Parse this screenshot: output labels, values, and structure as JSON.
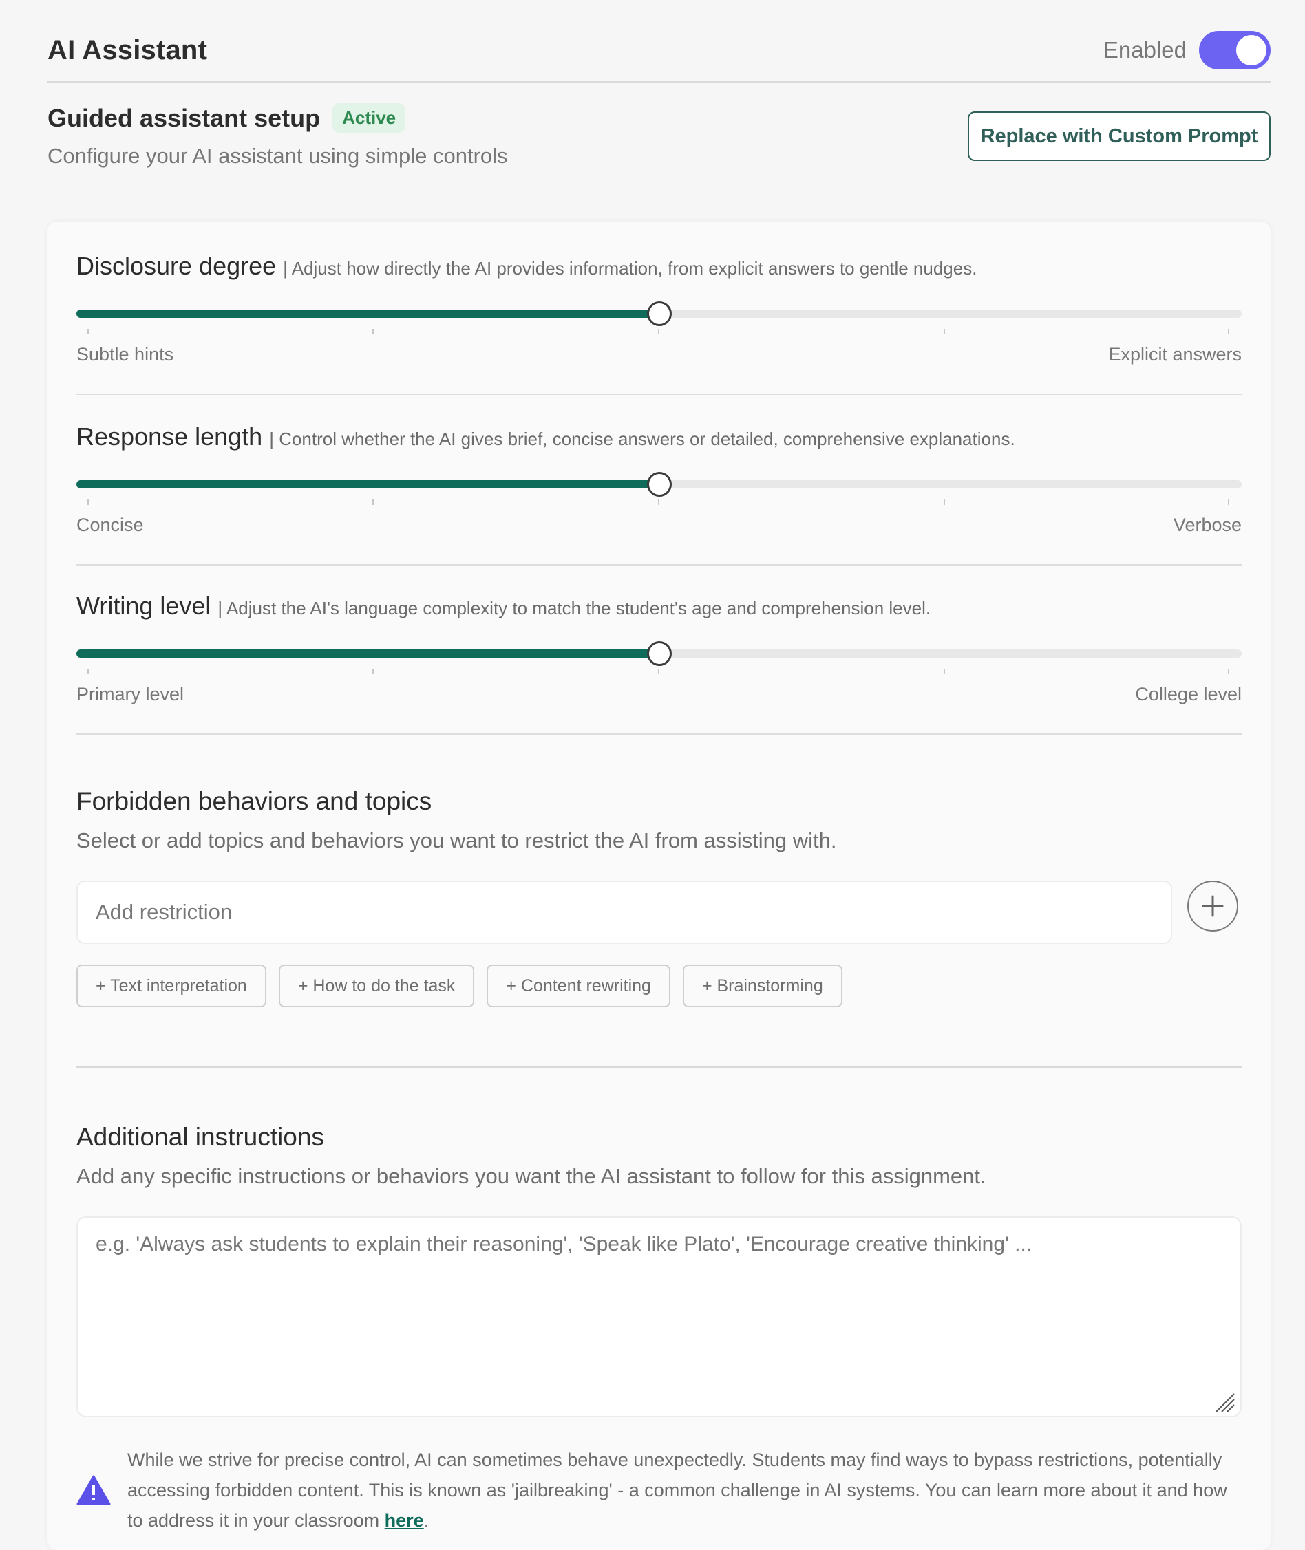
{
  "header": {
    "title": "AI Assistant",
    "enabled_label": "Enabled",
    "enabled": true
  },
  "guided": {
    "title": "Guided assistant setup",
    "badge": "Active",
    "subtitle": "Configure your AI assistant using simple controls",
    "replace_button": "Replace with Custom Prompt"
  },
  "sliders": [
    {
      "title": "Disclosure degree",
      "description": "| Adjust how directly the AI provides information, from explicit answers to gentle nudges.",
      "min_label": "Subtle hints",
      "max_label": "Explicit answers",
      "value": 0.5
    },
    {
      "title": "Response length",
      "description": "| Control whether the AI gives brief, concise answers or detailed, comprehensive explanations.",
      "min_label": "Concise",
      "max_label": "Verbose",
      "value": 0.5
    },
    {
      "title": "Writing level",
      "description": "| Adjust the AI's language complexity to match the student's age and comprehension level.",
      "min_label": "Primary level",
      "max_label": "College level",
      "value": 0.5
    }
  ],
  "forbidden": {
    "title": "Forbidden behaviors and topics",
    "subtitle": "Select or add topics and behaviors you want to restrict the AI from assisting with.",
    "input_placeholder": "Add restriction",
    "chips": [
      "+ Text interpretation",
      "+ How to do the task",
      "+ Content rewriting",
      "+ Brainstorming"
    ]
  },
  "instructions": {
    "title": "Additional instructions",
    "subtitle": "Add any specific instructions or behaviors you want the AI assistant to follow for this assignment.",
    "placeholder": "e.g. 'Always ask students to explain their reasoning', 'Speak like Plato', 'Encourage creative thinking' ..."
  },
  "warning": {
    "text": "While we strive for precise control, AI can sometimes behave unexpectedly. Students may find ways to bypass restrictions, potentially accessing forbidden content. This is known as 'jailbreaking' - a common challenge in AI systems. You can learn more about it and how to address it in your classroom ",
    "link_label": "here",
    "trailing": "."
  },
  "colors": {
    "accent": "#0f6b5a",
    "toggle": "#6c63f2",
    "badge_bg": "#e1f4e7",
    "badge_text": "#2f8a52",
    "warning_icon": "#5b50e8"
  }
}
